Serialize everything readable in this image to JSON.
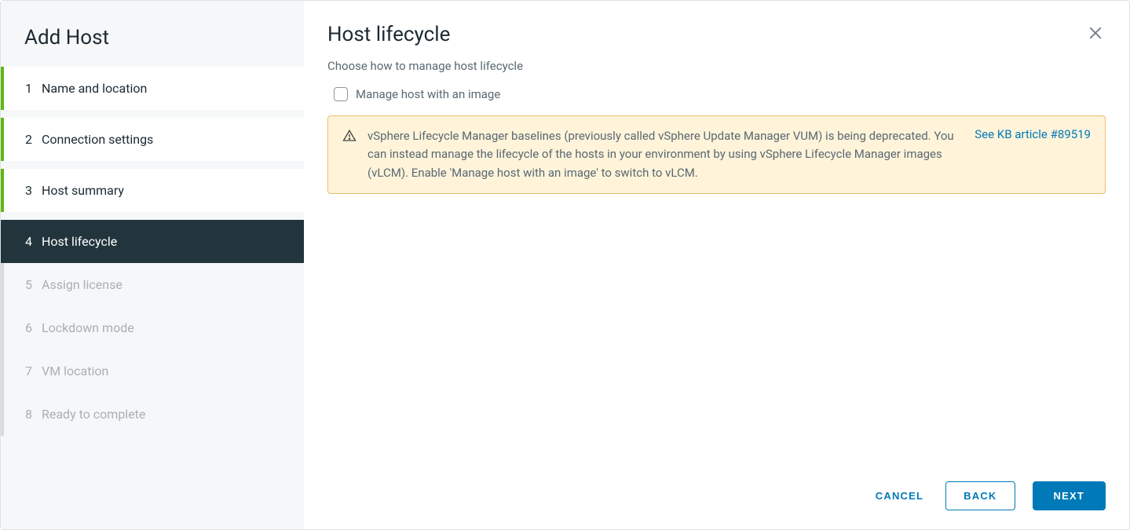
{
  "sidebar": {
    "title": "Add Host",
    "steps": [
      {
        "num": "1",
        "label": "Name and location",
        "state": "completed"
      },
      {
        "num": "2",
        "label": "Connection settings",
        "state": "completed"
      },
      {
        "num": "3",
        "label": "Host summary",
        "state": "completed"
      },
      {
        "num": "4",
        "label": "Host lifecycle",
        "state": "active"
      },
      {
        "num": "5",
        "label": "Assign license",
        "state": "upcoming"
      },
      {
        "num": "6",
        "label": "Lockdown mode",
        "state": "upcoming"
      },
      {
        "num": "7",
        "label": "VM location",
        "state": "upcoming"
      },
      {
        "num": "8",
        "label": "Ready to complete",
        "state": "upcoming"
      }
    ]
  },
  "main": {
    "title": "Host lifecycle",
    "subtitle": "Choose how to manage host lifecycle",
    "checkbox_label": "Manage host with an image",
    "alert": {
      "text": "vSphere Lifecycle Manager baselines (previously called vSphere Update Manager VUM) is being deprecated. You can instead manage the lifecycle of the hosts in your environment by using vSphere Lifecycle Manager images (vLCM). Enable 'Manage host with an image' to switch to vLCM.",
      "link": "See KB article #89519"
    }
  },
  "footer": {
    "cancel": "CANCEL",
    "back": "BACK",
    "next": "NEXT"
  }
}
